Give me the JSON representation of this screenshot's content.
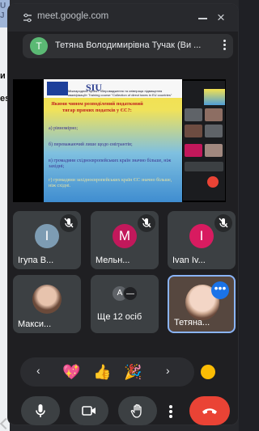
{
  "bubble": {
    "url": "meet.google.com",
    "meeting_title": "Тетяна Володимирівна Тучак (Ви ...",
    "avatar_letter": "T"
  },
  "background_page": {
    "fragments": [
      "U",
      "J",
      "и",
      "es"
    ]
  },
  "slide": {
    "logo_text": "SIU",
    "banner": "Міжнародний проєкт «Впровадження та співпраця підвищення кваліфікації» Training course \"Collection of direct taxes in EU countries\"",
    "question": "Якими чином розподілений податковий тягар прямих податків у ЄС?:",
    "options": [
      "а) рівномірно;",
      "б) переважаючий лише щодо ємігрантів;",
      "в) громадяни східноєвропейських країн значно більше, ніж західні;",
      "г) громадяни західноєвропейських країн ЄС значно більше, ніж східні."
    ]
  },
  "participants": [
    {
      "name": "Ігупа В...",
      "letter": "I",
      "avatar_color": "#7d9cb3",
      "muted": true
    },
    {
      "name": "Мельн...",
      "letter": "M",
      "avatar_color": "#c2185b",
      "muted": true
    },
    {
      "name": "Ivan Iv...",
      "letter": "I",
      "avatar_color": "#d81b60",
      "muted": true
    },
    {
      "name": "Макси...",
      "letter": "",
      "avatar_color": "#6b4a3a",
      "muted": false
    },
    {
      "name": "Ще 12 осіб",
      "letter": "",
      "avatar_color": "",
      "muted": false
    },
    {
      "name": "Тетяна...",
      "letter": "",
      "avatar_color": "",
      "muted": false
    }
  ],
  "more_avatars": [
    "A",
    "—"
  ],
  "reactions": {
    "emojis": [
      "💖",
      "👍",
      "🎉"
    ],
    "prev_icon": "‹",
    "next_icon": "›",
    "skin_tone_color": "#fbbc04"
  },
  "controls": {
    "mic_icon": "microphone-icon",
    "camera_icon": "camera-icon",
    "hand_icon": "raise-hand-icon",
    "more_icon": "more-vert-icon",
    "end_icon": "end-call-icon",
    "end_color": "#ea4335"
  },
  "more_button_glyph": "•••",
  "close_glyph": "×"
}
